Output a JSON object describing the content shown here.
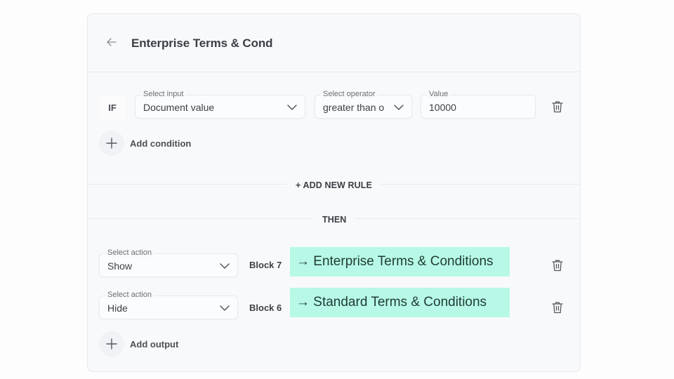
{
  "header": {
    "back_icon": "arrow-left-icon",
    "title": "Enterprise Terms & Cond"
  },
  "condition": {
    "if_label": "IF",
    "input": {
      "label": "Select input",
      "value": "Document value"
    },
    "operator": {
      "label": "Select operator",
      "value": "greater than o"
    },
    "value": {
      "label": "Value",
      "value": "10000"
    },
    "delete_icon": "trash-icon",
    "add_condition_label": "Add condition"
  },
  "add_new_rule_label": "+ ADD NEW RULE",
  "then_label": "THEN",
  "actions": [
    {
      "label": "Select action",
      "value": "Show",
      "block": "Block 7",
      "target": "→ Enterprise Terms & Conditions"
    },
    {
      "label": "Select action",
      "value": "Hide",
      "block": "Block 6",
      "target": "→ Standard Terms & Conditions"
    }
  ],
  "add_output_label": "Add output",
  "colors": {
    "highlight": "#b7f9e6",
    "card_background": "#f8f9fb",
    "text": "#3b3e44"
  }
}
